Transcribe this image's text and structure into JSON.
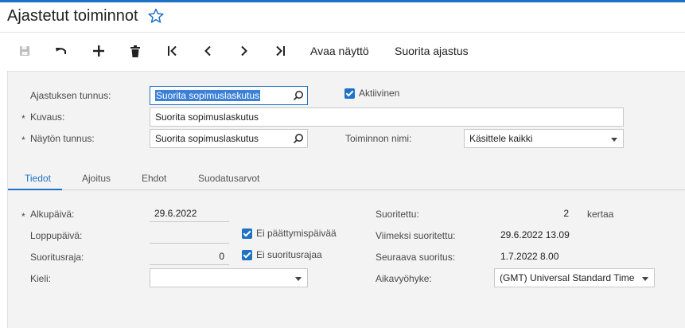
{
  "page": {
    "title": "Ajastetut toiminnot"
  },
  "toolbar": {
    "open_screen": "Avaa näyttö",
    "run_schedule": "Suorita ajastus"
  },
  "header_form": {
    "schedule_id_label": "Ajastuksen tunnus:",
    "schedule_id_value": "Suorita sopimuslaskutus",
    "active_label": "Aktiivinen",
    "description_label": "Kuvaus:",
    "description_value": "Suorita sopimuslaskutus",
    "screen_id_label": "Näytön tunnus:",
    "screen_id_value": "Suorita sopimuslaskutus",
    "action_name_label": "Toiminnon nimi:",
    "action_name_value": "Käsittele kaikki",
    "required_mark": "*"
  },
  "tabs": [
    {
      "label": "Tiedot"
    },
    {
      "label": "Ajoitus"
    },
    {
      "label": "Ehdot"
    },
    {
      "label": "Suodatusarvot"
    }
  ],
  "details": {
    "start_date_label": "Alkupäivä:",
    "start_date_value": "29.6.2022",
    "end_date_label": "Loppupäivä:",
    "end_date_value": "",
    "no_end_date_label": "Ei päättymispäivää",
    "run_limit_label": "Suoritusraja:",
    "run_limit_value": "0",
    "no_run_limit_label": "Ei suoritusrajaa",
    "language_label": "Kieli:",
    "language_value": "",
    "executed_label": "Suoritettu:",
    "executed_value": "2",
    "executed_unit": "kertaa",
    "last_run_label": "Viimeksi suoritettu:",
    "last_run_value": "29.6.2022 13.09",
    "next_run_label": "Seuraava suoritus:",
    "next_run_value": "1.7.2022 8.00",
    "timezone_label": "Aikavyöhyke:",
    "timezone_value": "(GMT) Universal Standard Time"
  },
  "colors": {
    "accent": "#1e72c6",
    "form_bg": "#f3f3f3"
  },
  "icons": [
    "star-icon",
    "save-icon",
    "undo-icon",
    "add-icon",
    "delete-icon",
    "first-icon",
    "previous-icon",
    "next-icon",
    "last-icon",
    "search-icon",
    "chevron-down-icon",
    "checkbox-checked-icon"
  ]
}
